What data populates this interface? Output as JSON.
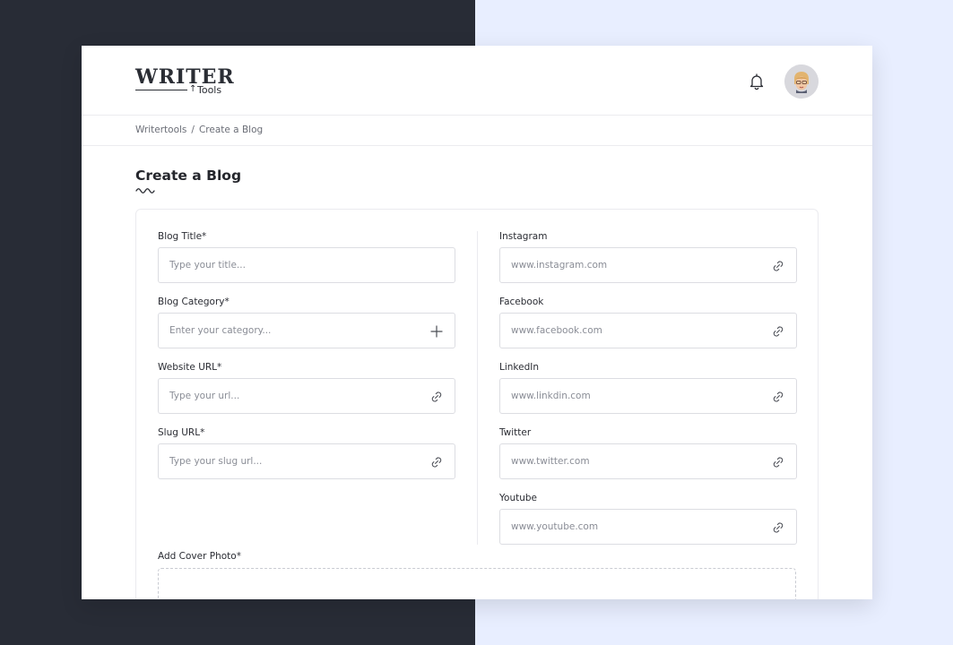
{
  "app": {
    "logo_top": "WRITER",
    "logo_bottom": "Tools"
  },
  "breadcrumb": {
    "items": [
      "Writertools",
      "Create a Blog"
    ],
    "separator": "/"
  },
  "page": {
    "title": "Create a Blog"
  },
  "form": {
    "left": [
      {
        "label": "Blog Title*",
        "placeholder": "Type your title...",
        "icon": "none"
      },
      {
        "label": "Blog Category*",
        "placeholder": "Enter your category...",
        "icon": "plus-icon"
      },
      {
        "label": "Website URL*",
        "placeholder": "Type your url...",
        "icon": "link-icon"
      },
      {
        "label": "Slug URL*",
        "placeholder": "Type your slug url...",
        "icon": "link-icon"
      }
    ],
    "right": [
      {
        "label": "Instagram",
        "placeholder": "www.instagram.com",
        "icon": "link-icon"
      },
      {
        "label": "Facebook",
        "placeholder": "www.facebook.com",
        "icon": "link-icon"
      },
      {
        "label": "LinkedIn",
        "placeholder": "www.linkdin.com",
        "icon": "link-icon"
      },
      {
        "label": "Twitter",
        "placeholder": "www.twitter.com",
        "icon": "link-icon"
      },
      {
        "label": "Youtube",
        "placeholder": "www.youtube.com",
        "icon": "link-icon"
      }
    ],
    "cover_label": "Add Cover Photo*"
  },
  "colors": {
    "dark_panel": "#282c36",
    "light_panel": "#e8eeff",
    "text": "#24262c",
    "border": "#dcdde2"
  }
}
